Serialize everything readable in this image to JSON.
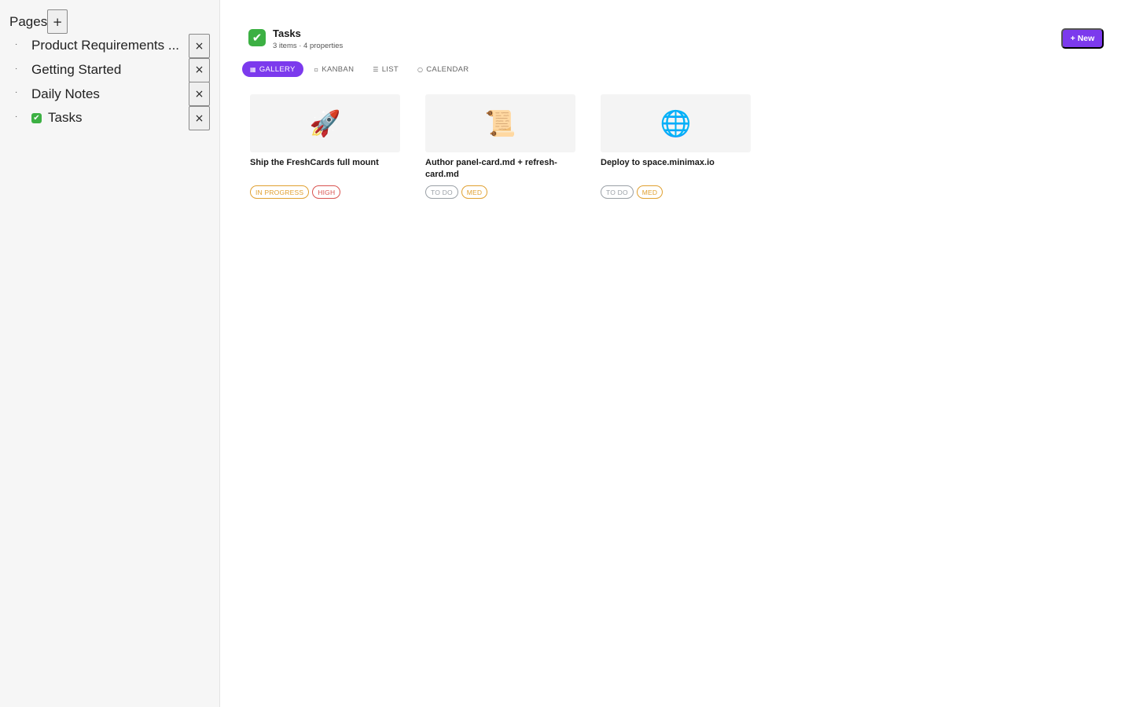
{
  "sidebar": {
    "title": "Pages",
    "add_label": "+",
    "remove_label": "×",
    "items": [
      {
        "label": "Product Requirements ...",
        "emoji": ""
      },
      {
        "label": "Getting Started",
        "emoji": ""
      },
      {
        "label": "Daily Notes",
        "emoji": ""
      },
      {
        "label": "Tasks",
        "emoji": "✔"
      }
    ],
    "bullet": "·"
  },
  "database": {
    "icon": "✔",
    "title": "Tasks",
    "meta": "3 items · 4 properties",
    "new_button": "+ New"
  },
  "tabs": [
    {
      "icon": "▦",
      "label": "GALLERY",
      "active": true
    },
    {
      "icon": "▫",
      "label": "KANBAN",
      "active": false
    },
    {
      "icon": "☰",
      "label": "LIST",
      "active": false
    },
    {
      "icon": "○",
      "label": "CALENDAR",
      "active": false
    }
  ],
  "cards": [
    {
      "cover_icon": "🚀",
      "cover_icon_name": "rocket-icon",
      "title": "Ship the FreshCards full mount",
      "status": {
        "label": "IN PROGRESS",
        "color": "#e0a030"
      },
      "priority": {
        "label": "HIGH",
        "color": "#d9534f"
      }
    },
    {
      "cover_icon": "📜",
      "cover_icon_name": "scroll-icon",
      "title": "Author panel-card.md + refresh-card.md",
      "status": {
        "label": "TO DO",
        "color": "#9aa0a6"
      },
      "priority": {
        "label": "MED",
        "color": "#e0a030"
      }
    },
    {
      "cover_icon": "🌐",
      "cover_icon_name": "globe-icon",
      "title": "Deploy to space.minimax.io",
      "status": {
        "label": "TO DO",
        "color": "#9aa0a6"
      },
      "priority": {
        "label": "MED",
        "color": "#e0a030"
      }
    }
  ],
  "colors": {
    "accent": "#7c3aed",
    "sidebar_bg": "#f6f6f6"
  }
}
